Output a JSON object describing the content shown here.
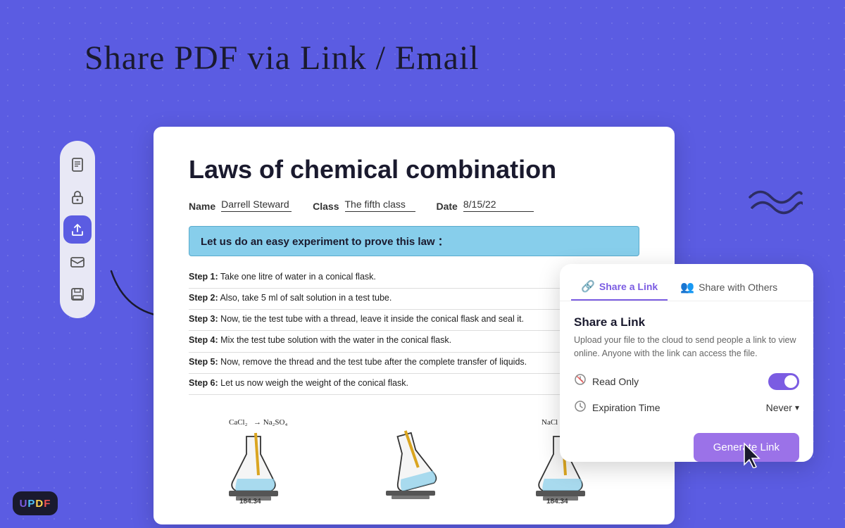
{
  "header": {
    "title": "Share PDF via Link / Email"
  },
  "sidebar": {
    "items": [
      {
        "id": "document-icon",
        "label": "Document",
        "active": false
      },
      {
        "id": "lock-icon",
        "label": "Lock",
        "active": false
      },
      {
        "id": "share-icon",
        "label": "Share",
        "active": true
      },
      {
        "id": "email-icon",
        "label": "Email",
        "active": false
      },
      {
        "id": "save-icon",
        "label": "Save",
        "active": false
      }
    ]
  },
  "pdf": {
    "title": "Laws of chemical combination",
    "meta": {
      "name_label": "Name",
      "name_value": "Darrell Steward",
      "class_label": "Class",
      "class_value": "The fifth class",
      "date_label": "Date",
      "date_value": "8/15/22"
    },
    "highlight": "Let us do an easy experiment to prove this law ：",
    "steps": [
      {
        "label": "Step 1:",
        "text": "Take one litre of water in a conical flask."
      },
      {
        "label": "Step 2:",
        "text": "Also, take 5 ml of salt solution in a test tube."
      },
      {
        "label": "Step 3:",
        "text": "Now, tie the test tube with a thread, leave it inside the conical flask and seal it."
      },
      {
        "label": "Step 4:",
        "text": "Mix the test tube solution with the water in the conical flask."
      },
      {
        "label": "Step 5:",
        "text": "Now, remove the thread and the test tube after the complete transfer of liquids."
      },
      {
        "label": "Step 6:",
        "text": "Let us now weigh the weight of the conical flask."
      }
    ],
    "flask_labels": [
      "CaCl₂",
      "Na₂SO₄",
      "",
      "NaCl"
    ]
  },
  "share_panel": {
    "tabs": [
      {
        "id": "share-link",
        "label": "Share a Link",
        "active": true
      },
      {
        "id": "share-others",
        "label": "Share with Others",
        "active": false
      }
    ],
    "section_title": "Share a Link",
    "description": "Upload your file to the cloud to send people a link to view online. Anyone with the link can access the file.",
    "read_only_label": "Read Only",
    "expiration_label": "Expiration Time",
    "expiration_value": "Never",
    "generate_btn_label": "Generate Link"
  },
  "updf_logo": "UPDF"
}
